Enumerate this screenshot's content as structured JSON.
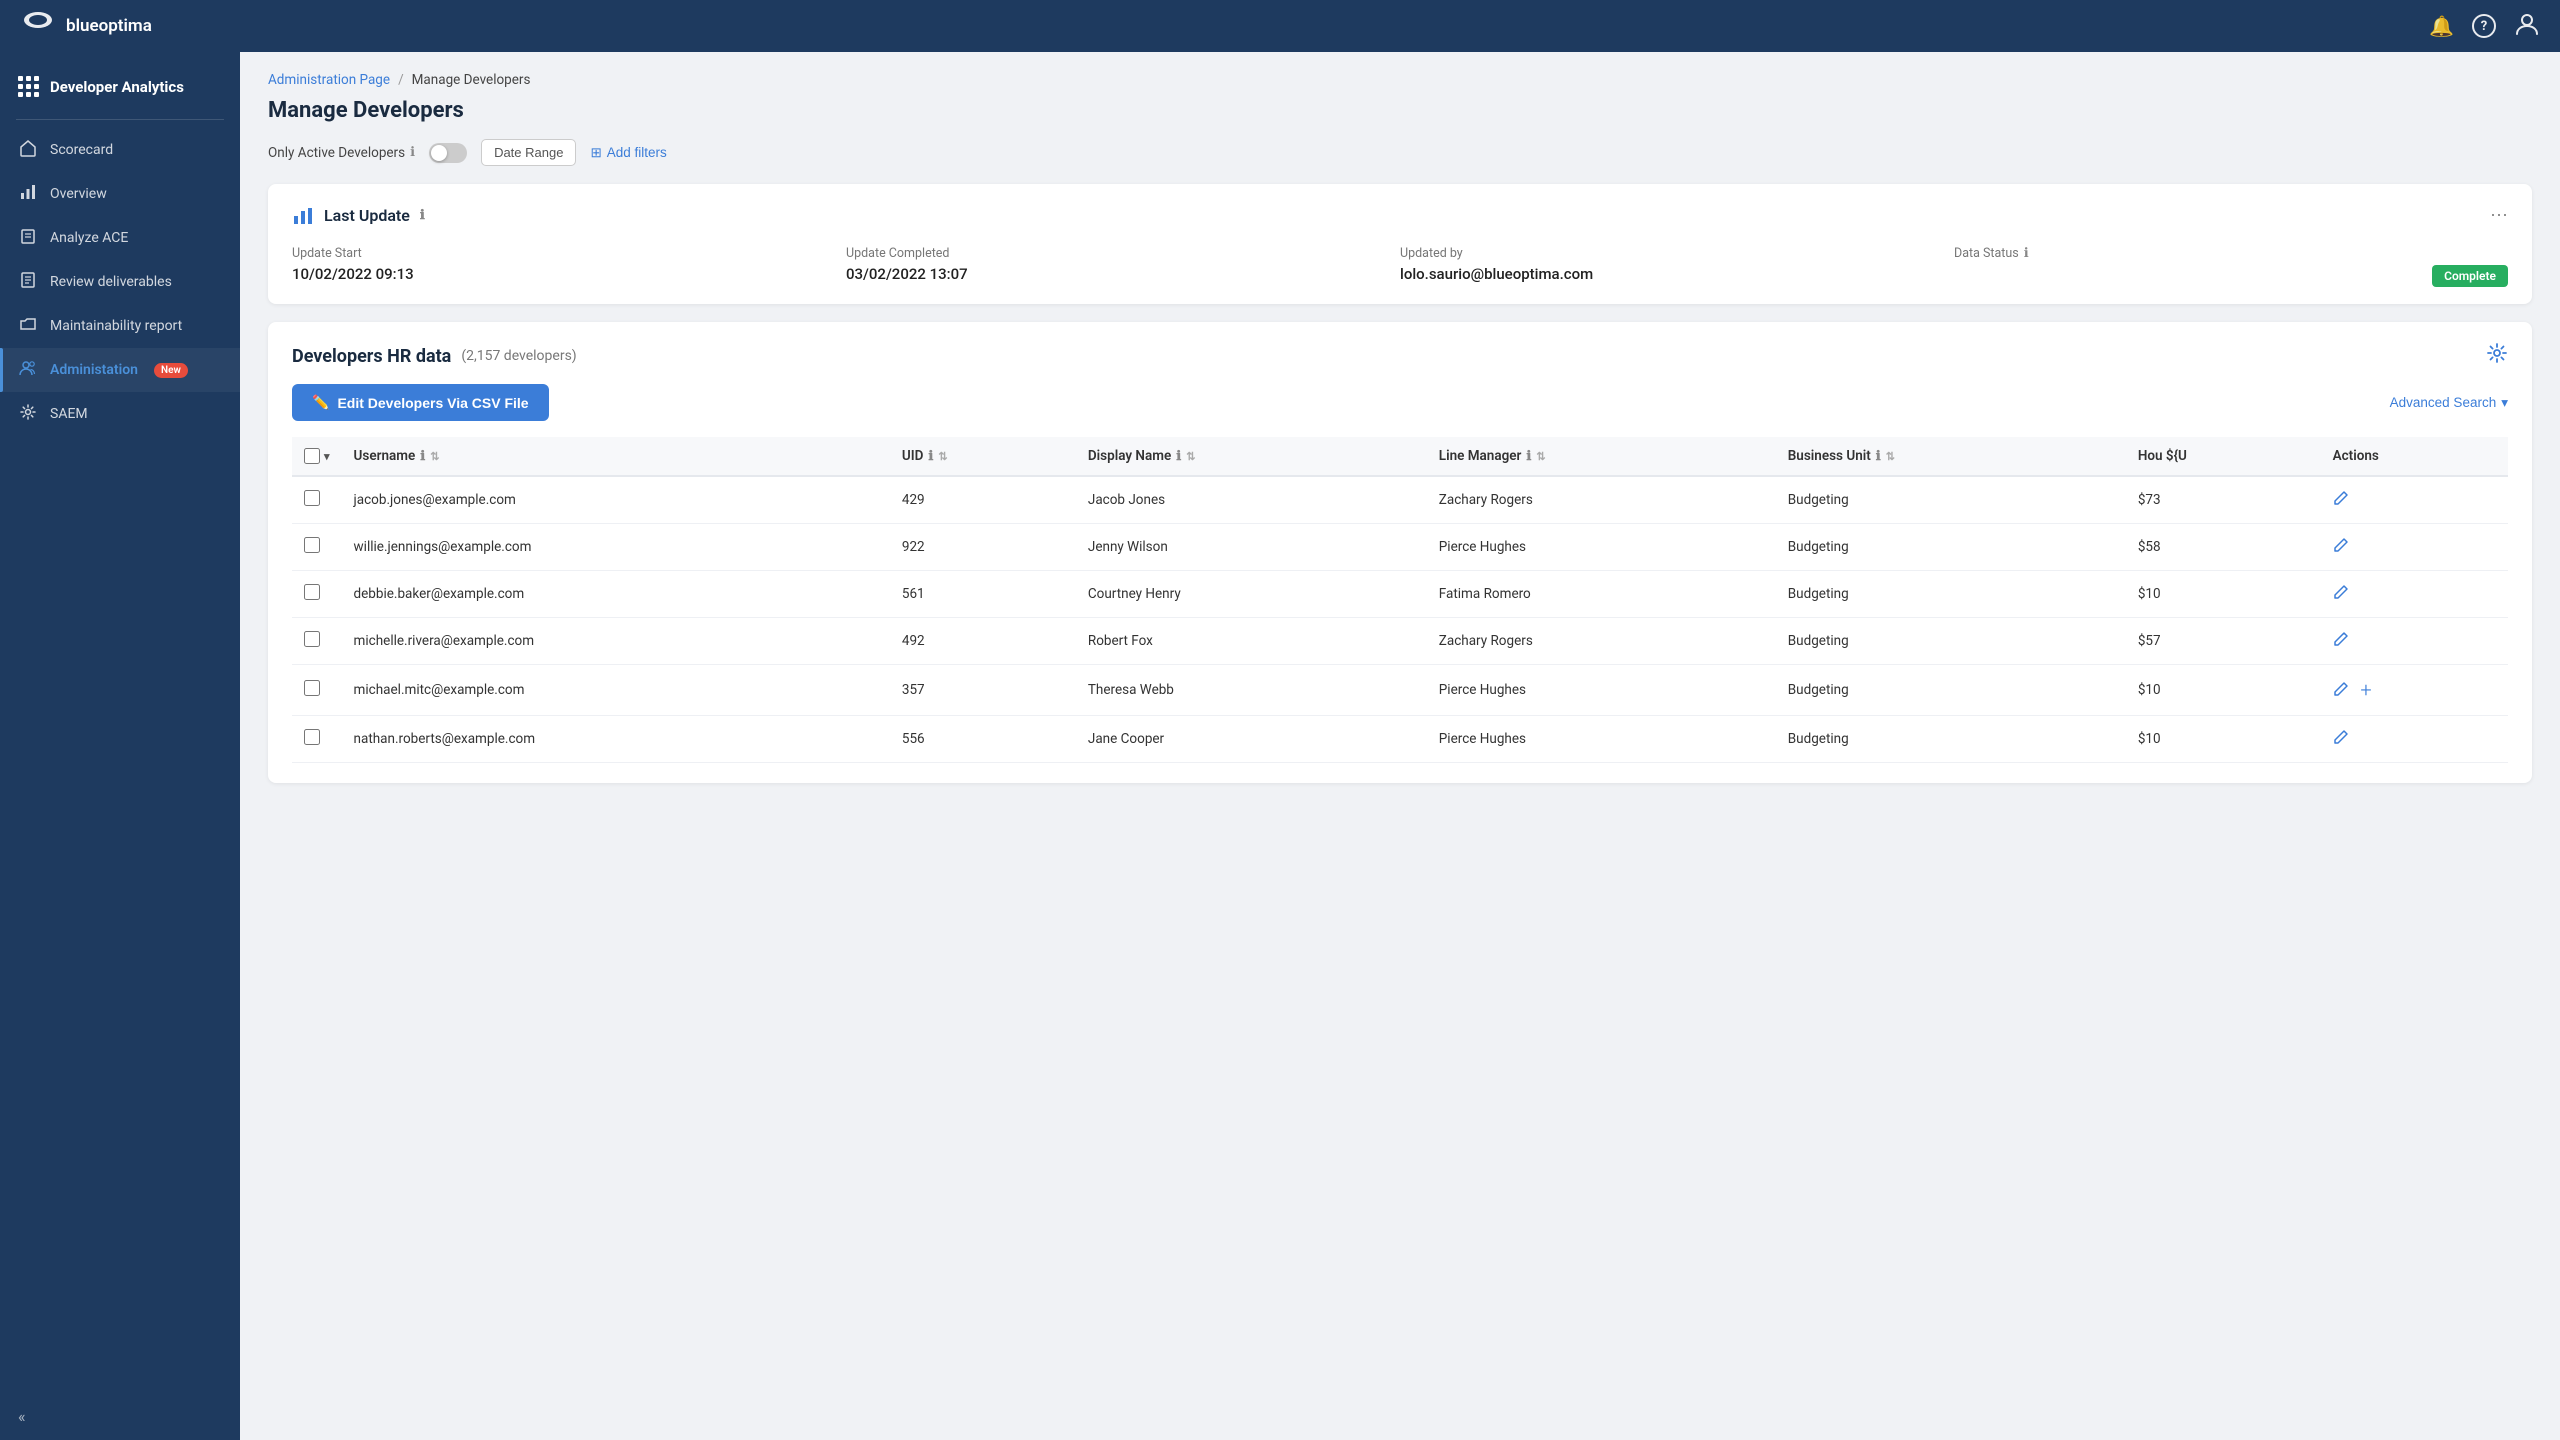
{
  "topnav": {
    "logo_text": "blueoptima",
    "notification_icon": "🔔",
    "help_icon": "?",
    "user_icon": "👤"
  },
  "sidebar": {
    "app_title": "Developer Analytics",
    "items": [
      {
        "id": "scorecard",
        "label": "Scorecard",
        "icon": "🏠"
      },
      {
        "id": "overview",
        "label": "Overview",
        "icon": "📊"
      },
      {
        "id": "analyze-ace",
        "label": "Analyze ACE",
        "icon": "📋"
      },
      {
        "id": "review-deliverables",
        "label": "Review deliverables",
        "icon": "📄"
      },
      {
        "id": "maintainability-report",
        "label": "Maintainability report",
        "icon": "🗂"
      },
      {
        "id": "administration",
        "label": "Administation",
        "icon": "👥",
        "active": true,
        "badge": "New"
      },
      {
        "id": "saem",
        "label": "SAEM",
        "icon": "⚙"
      }
    ],
    "collapse_icon": "«"
  },
  "breadcrumb": {
    "parent": "Administration Page",
    "separator": "/",
    "current": "Manage Developers"
  },
  "page": {
    "title": "Manage Developers",
    "filters": {
      "active_developers_label": "Only Active Developers",
      "toggle_state": "off",
      "date_range_label": "Date Range",
      "add_filters_label": "Add filters"
    }
  },
  "last_update_card": {
    "title": "Last Update",
    "update_start_label": "Update Start",
    "update_start_value": "10/02/2022 09:13",
    "update_completed_label": "Update Completed",
    "update_completed_value": "03/02/2022 13:07",
    "updated_by_label": "Updated by",
    "updated_by_value": "lolo.saurio@blueoptima.com",
    "data_status_label": "Data Status",
    "data_status_value": "Complete"
  },
  "hr_data": {
    "title": "Developers HR data",
    "count": "(2,157 developers)",
    "csv_button_label": "Edit Developers Via CSV File",
    "advanced_search_label": "Advanced Search",
    "table": {
      "columns": [
        {
          "id": "username",
          "label": "Username",
          "sortable": true,
          "info": true
        },
        {
          "id": "uid",
          "label": "UID",
          "sortable": true,
          "info": true
        },
        {
          "id": "display_name",
          "label": "Display Name",
          "sortable": true,
          "info": true
        },
        {
          "id": "line_manager",
          "label": "Line Manager",
          "sortable": true,
          "info": true
        },
        {
          "id": "business_unit",
          "label": "Business Unit",
          "sortable": true,
          "info": true
        },
        {
          "id": "hours",
          "label": "Hou ${U",
          "sortable": false,
          "info": false
        },
        {
          "id": "actions",
          "label": "Actions",
          "sortable": false,
          "info": false
        }
      ],
      "rows": [
        {
          "username": "jacob.jones@example.com",
          "uid": "429",
          "display_name": "Jacob Jones",
          "line_manager": "Zachary Rogers",
          "business_unit": "Budgeting",
          "hours": "$73"
        },
        {
          "username": "willie.jennings@example.com",
          "uid": "922",
          "display_name": "Jenny Wilson",
          "line_manager": "Pierce Hughes",
          "business_unit": "Budgeting",
          "hours": "$58"
        },
        {
          "username": "debbie.baker@example.com",
          "uid": "561",
          "display_name": "Courtney Henry",
          "line_manager": "Fatima Romero",
          "business_unit": "Budgeting",
          "hours": "$10"
        },
        {
          "username": "michelle.rivera@example.com",
          "uid": "492",
          "display_name": "Robert Fox",
          "line_manager": "Zachary Rogers",
          "business_unit": "Budgeting",
          "hours": "$57"
        },
        {
          "username": "michael.mitc@example.com",
          "uid": "357",
          "display_name": "Theresa Webb",
          "line_manager": "Pierce Hughes",
          "business_unit": "Budgeting",
          "hours": "$10"
        },
        {
          "username": "nathan.roberts@example.com",
          "uid": "556",
          "display_name": "Jane Cooper",
          "line_manager": "Pierce Hughes",
          "business_unit": "Budgeting",
          "hours": "$10"
        }
      ]
    }
  }
}
